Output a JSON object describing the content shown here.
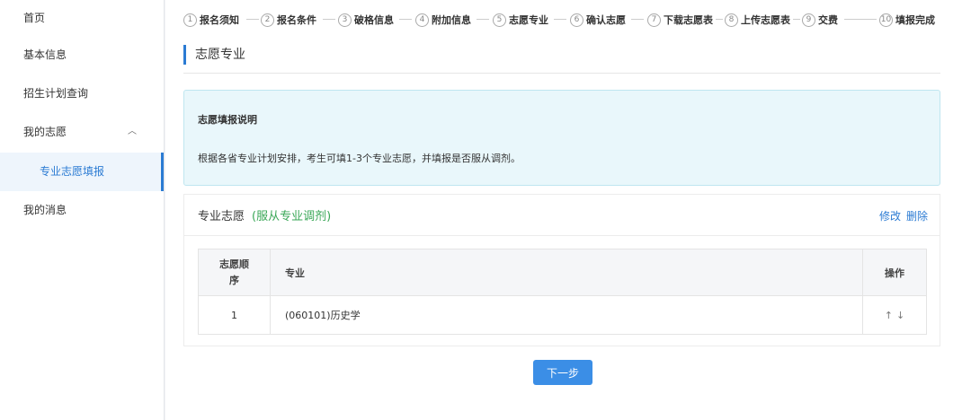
{
  "sidebar": {
    "items": [
      {
        "label": "首页"
      },
      {
        "label": "基本信息"
      },
      {
        "label": "招生计划查询"
      },
      {
        "label": "我的志愿"
      },
      {
        "label": "专业志愿填报"
      },
      {
        "label": "我的消息"
      }
    ]
  },
  "steps": [
    {
      "num": "1",
      "label": "报名须知"
    },
    {
      "num": "2",
      "label": "报名条件"
    },
    {
      "num": "3",
      "label": "破格信息"
    },
    {
      "num": "4",
      "label": "附加信息"
    },
    {
      "num": "5",
      "label": "志愿专业"
    },
    {
      "num": "6",
      "label": "确认志愿"
    },
    {
      "num": "7",
      "label": "下载志愿表"
    },
    {
      "num": "8",
      "label": "上传志愿表"
    },
    {
      "num": "9",
      "label": "交费"
    },
    {
      "num": "10",
      "label": "填报完成"
    }
  ],
  "page": {
    "section_title": "志愿专业"
  },
  "notice": {
    "title": "志愿填报说明",
    "text": "根据各省专业计划安排，考生可填1-3个专业志愿，并填报是否服从调剂。"
  },
  "card": {
    "title": "专业志愿",
    "subtitle": "(服从专业调剂)",
    "edit_label": "修改",
    "delete_label": "删除"
  },
  "table": {
    "headers": [
      "志愿顺序",
      "专业",
      "操作"
    ],
    "rows": [
      {
        "order": "1",
        "major": "(060101)历史学",
        "up": "↑",
        "down": "↓"
      }
    ]
  },
  "next_button": "下一步",
  "colors": {
    "accent": "#2b7bd3",
    "button": "#3b8ee6",
    "green": "#3aa757",
    "notice_bg": "#e9f7fb"
  }
}
